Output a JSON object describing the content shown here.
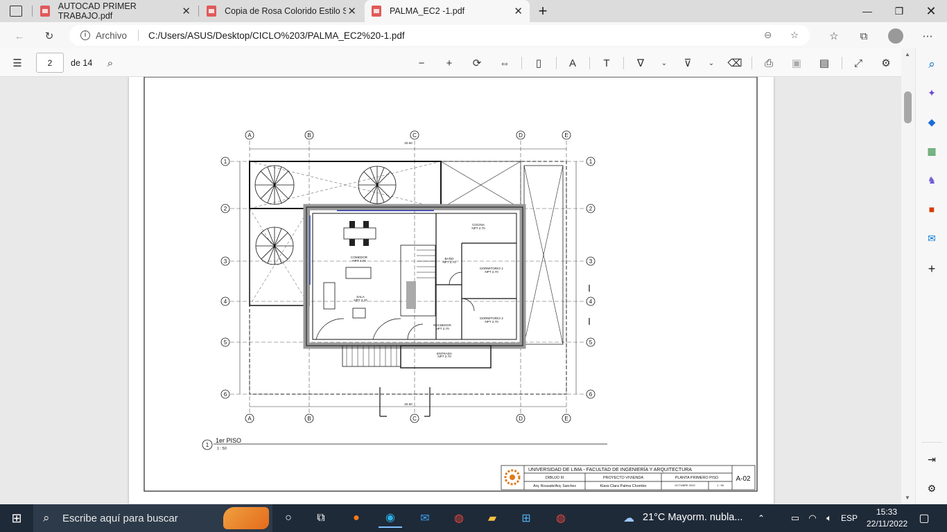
{
  "tabs": [
    {
      "title": "AUTOCAD PRIMER TRABAJO.pdf"
    },
    {
      "title": "Copia de Rosa Colorido Estilo Se"
    },
    {
      "title": "PALMA_EC2 -1.pdf"
    }
  ],
  "address": {
    "site_label": "Archivo",
    "url": "C:/Users/ASUS/Desktop/CICLO%203/PALMA_EC2%20-1.pdf"
  },
  "pdf_toolbar": {
    "page_number": "2",
    "page_total": "de 14"
  },
  "drawing": {
    "grid_letters": [
      "A",
      "B",
      "C",
      "D",
      "E"
    ],
    "grid_numbers": [
      "1",
      "2",
      "3",
      "4",
      "5",
      "6"
    ],
    "rooms": [
      {
        "name": "COMEDOR",
        "level": "NPT 2.70"
      },
      {
        "name": "SALA",
        "level": "NPT 2.70"
      },
      {
        "name": "COCINA",
        "level": "NPT 2.70"
      },
      {
        "name": "BAÑO",
        "level": "NPT 2.70"
      },
      {
        "name": "DORMITORIO 1",
        "level": "NPT 2.70"
      },
      {
        "name": "DORMITORIO 2",
        "level": "NPT 2.70"
      },
      {
        "name": "RECIBIDOR",
        "level": "NPT 2.70"
      },
      {
        "name": "ENTRADA",
        "level": "NPT 2.70"
      }
    ],
    "total_dim": "20.60",
    "caption_number": "1",
    "caption_title": "1er PISO",
    "caption_scale": "1 : 50"
  },
  "title_block": {
    "university": "UNIVERSIDAD DE LIMA - FACULTAD DE INGENIERÍA Y ARQUITECTURA",
    "course": "DIBUJO III",
    "project": "PROYECTO VIVIENDA",
    "sheet_name": "PLANTA PRIMERO PISO",
    "sheet_code": "A-02",
    "teachers": "Arq. Rossado/Arq. Sanchez",
    "student": "Kiara Clara Palma Chombo",
    "date": "OCTUBRE 2022",
    "scale": "1 : 50"
  },
  "taskbar": {
    "search_placeholder": "Escribe aquí para buscar",
    "weather": "21°C  Mayorm. nubla...",
    "lang": "ESP",
    "time": "15:33",
    "date": "22/11/2022"
  },
  "colors": {
    "taskbar": "#1f2a38",
    "accent": "#0067c0",
    "pdf_icon": "#e05a5a"
  }
}
